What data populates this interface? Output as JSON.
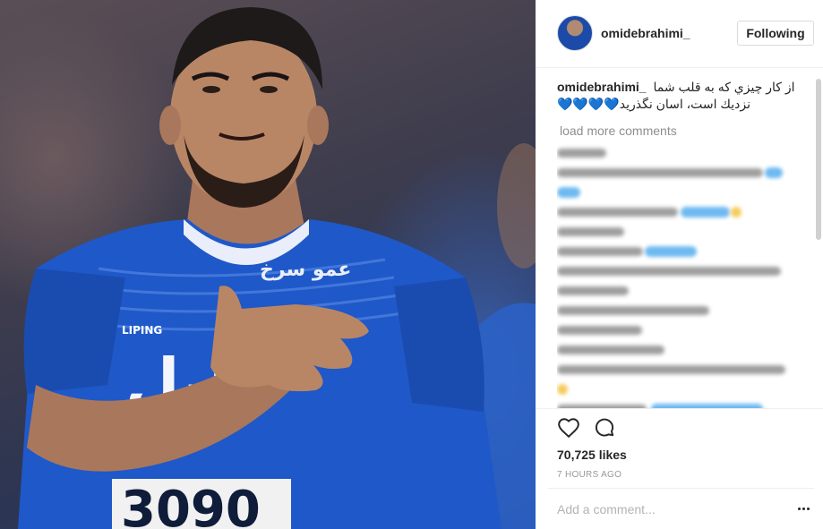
{
  "post": {
    "jersey_number": "3090",
    "jersey_brand": "LIPING",
    "sponsor_text": "عمو سرخ",
    "colors": {
      "jersey": "#1f58c8",
      "background_dark": "#3f3d4d",
      "skin": "#b98665"
    }
  },
  "header": {
    "username": "omidebrahimi_",
    "follow_label": "Following"
  },
  "caption": {
    "username": "omidebrahimi_",
    "text": "از كار چيزي كه به قلب شما نزديك است، اسان نگذريد💙💙💙💙"
  },
  "comments": {
    "load_more_label": "load more comments",
    "blurred_count": 14
  },
  "actions": {
    "like_icon": "heart-icon",
    "comment_icon": "comment-icon"
  },
  "likes": "70,725 likes",
  "timestamp": "7 HOURS AGO",
  "add_comment": {
    "placeholder": "Add a comment..."
  },
  "more_icon": "ellipsis-icon"
}
